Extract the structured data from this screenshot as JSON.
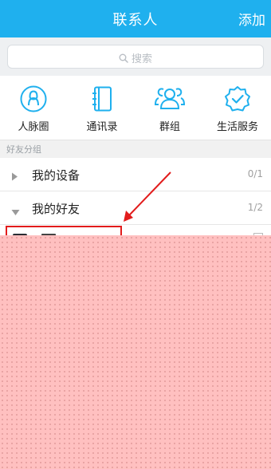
{
  "header": {
    "title": "联系人",
    "add_label": "添加"
  },
  "search": {
    "placeholder": "搜索"
  },
  "shortcuts": [
    {
      "label": "人脉圈",
      "icon": "contacts-circle-icon"
    },
    {
      "label": "通讯录",
      "icon": "address-book-icon"
    },
    {
      "label": "群组",
      "icon": "group-icon"
    },
    {
      "label": "生活服务",
      "icon": "life-service-icon"
    }
  ],
  "section": {
    "title": "好友分组"
  },
  "groups": [
    {
      "name": "我的设备",
      "count": "0/1",
      "expanded": false
    },
    {
      "name": "我的好友",
      "count": "1/2",
      "expanded": true
    }
  ],
  "colors": {
    "accent": "#1fb0ee",
    "highlight": "#e21c1c",
    "redaction": "#ffc0c0"
  }
}
